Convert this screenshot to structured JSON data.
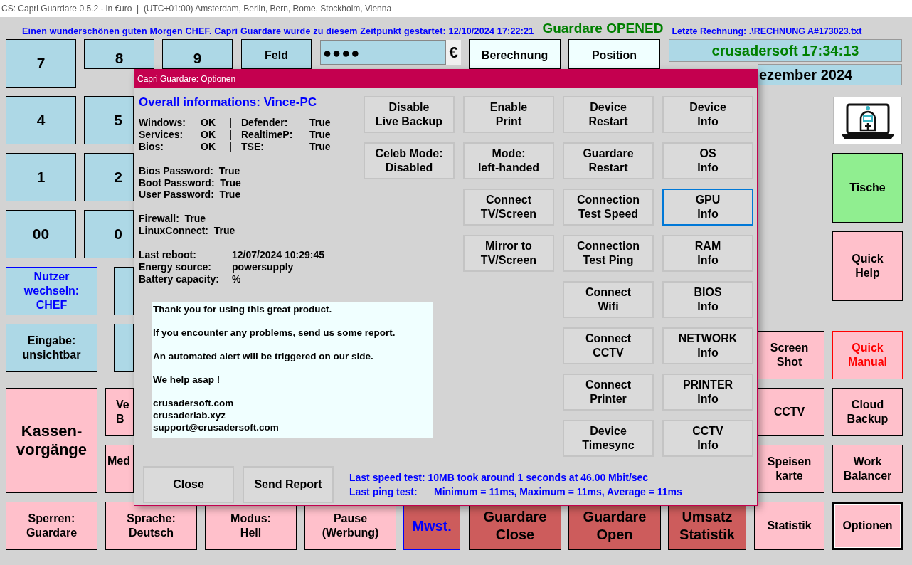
{
  "window": {
    "title": "CS: Capri Guardare 0.5.2 - in €uro  |  (UTC+01:00) Amsterdam, Berlin, Bern, Rome, Stockholm, Vienna"
  },
  "header": {
    "greeting": "Einen wunderschönen guten Morgen CHEF. Capri Guardare wurde zu diesem Zeitpunkt gestartet: 12/10/2024 17:22:21",
    "status": "Guardare OPENED",
    "last_invoice": "Letzte Rechnung: .\\RECHNUNG A#173023.txt"
  },
  "pin_field": {
    "value": "●●●●",
    "currency": "€"
  },
  "clock": "crusadersoft 17:34:13",
  "date": "ezember 2024",
  "buttons": [
    {
      "label": "7",
      "kind": "digit",
      "color": "#add8e6",
      "focused": false
    },
    {
      "label": "8",
      "kind": "digit",
      "color": "#add8e6",
      "focused": false
    },
    {
      "label": "9",
      "kind": "digit",
      "color": "#add8e6",
      "focused": false
    },
    {
      "label": "Feld",
      "kind": "normal",
      "color": "#add8e6",
      "focused": false
    },
    {
      "label": "Berechnung",
      "kind": "normal",
      "color": "#f0ffff",
      "focused": false
    },
    {
      "label": "Position",
      "kind": "normal",
      "color": "#f0ffff",
      "focused": false
    },
    {
      "label": "4",
      "kind": "digit",
      "color": "#add8e6",
      "focused": false
    },
    {
      "label": "5",
      "kind": "digit",
      "color": "#add8e6",
      "focused": false
    },
    {
      "label": "1",
      "kind": "digit",
      "color": "#add8e6",
      "focused": false
    },
    {
      "label": "2",
      "kind": "digit",
      "color": "#add8e6",
      "focused": false
    },
    {
      "label": "00",
      "kind": "digit",
      "color": "#add8e6",
      "focused": false
    },
    {
      "label": "0",
      "kind": "digit",
      "color": "#add8e6",
      "focused": false
    },
    {
      "label": "Nutzer\nwechseln:\nCHEF",
      "kind": "user",
      "color": "#add8e6",
      "focused": false
    },
    {
      "label": "Eingabe:\nunsichtbar",
      "kind": "normal",
      "color": "#add8e6",
      "focused": false
    },
    {
      "label": "Kassen-\nvorgänge",
      "kind": "large",
      "color": "#ffc0cb",
      "focused": false
    },
    {
      "label": "Ve\nB",
      "kind": "normal",
      "color": "#ffc0cb",
      "focused": false
    },
    {
      "label": "Med",
      "kind": "normal",
      "color": "#ffc0cb",
      "focused": false
    },
    {
      "label": "Sperren:\nGuardare",
      "kind": "normal",
      "color": "#ffc0cb",
      "focused": false
    },
    {
      "label": "Sprache:\nDeutsch",
      "kind": "normal",
      "color": "#ffc0cb",
      "focused": false
    },
    {
      "label": "Modus:\nHell",
      "kind": "normal",
      "color": "#ffc0cb",
      "focused": false
    },
    {
      "label": "Pause\n(Werbung)",
      "kind": "normal",
      "color": "#ffc0cb",
      "focused": false
    },
    {
      "label": "Mwst.",
      "kind": "tax",
      "color": "#cd5c5c",
      "focused": false
    },
    {
      "label": "Guardare\nClose",
      "kind": "medium",
      "color": "#cd5c5c",
      "focused": false
    },
    {
      "label": "Guardare\nOpen",
      "kind": "medium",
      "color": "#cd5c5c",
      "focused": false
    },
    {
      "label": "Umsatz\nStatistik",
      "kind": "medium",
      "color": "#cd5c5c",
      "focused": false
    },
    {
      "label": "Tische",
      "kind": "normal",
      "color": "#90ee90",
      "focused": false
    },
    {
      "label": "Quick\nHelp",
      "kind": "normal",
      "color": "#ffc0cb",
      "focused": false
    },
    {
      "label": "Screen\nShot",
      "kind": "normal",
      "color": "#ffc0cb",
      "focused": false
    },
    {
      "label": "Quick\nManual",
      "kind": "alert",
      "color": "#ffc0cb",
      "focused": false
    },
    {
      "label": "CCTV",
      "kind": "normal",
      "color": "#ffc0cb",
      "focused": false
    },
    {
      "label": "Cloud\nBackup",
      "kind": "normal",
      "color": "#ffc0cb",
      "focused": false
    },
    {
      "label": "Speisen\nkarte",
      "kind": "normal",
      "color": "#ffc0cb",
      "focused": false
    },
    {
      "label": "Work\nBalancer",
      "kind": "normal",
      "color": "#ffc0cb",
      "focused": false
    },
    {
      "label": "Statistik",
      "kind": "normal",
      "color": "#ffc0cb",
      "focused": false
    },
    {
      "label": "Optionen",
      "kind": "normal",
      "color": "#ffc0cb",
      "focused": true
    }
  ],
  "dialog": {
    "title": "Capri Guardare: Optionen",
    "heading": "Overall informations: Vince-PC",
    "status_rows": [
      [
        "Windows:",
        "OK",
        "|",
        "Defender:",
        "True"
      ],
      [
        "Services:",
        "OK",
        "|",
        "RealtimeP:",
        "True"
      ],
      [
        "Bios:",
        "OK",
        "|",
        "TSE:",
        "True"
      ]
    ],
    "password_lines": [
      "Bios Password:  True",
      "Boot Password:  True",
      "User Password:  True"
    ],
    "connection_lines": [
      "Firewall:  True",
      "LinuxConnect:  True"
    ],
    "system_rows": [
      {
        "label": "Last reboot:",
        "value": "12/07/2024 10:29:45"
      },
      {
        "label": "Energy source:",
        "value": "powersupply"
      },
      {
        "label": "Battery capacity:",
        "value": "%"
      }
    ],
    "message": [
      "Thank you for using this great product.",
      "If you encounter any problems, send us some report.",
      "An automated alert will be triggered on our side.",
      "We help asap !",
      "crusadersoft.com\ncrusaderlab.xyz\nsupport@crusadersoft.com"
    ],
    "action_columns": [
      [
        {
          "label": "Disable\nLive Backup",
          "focused": false
        },
        {
          "label": "Celeb Mode:\nDisabled",
          "focused": false
        }
      ],
      [
        {
          "label": "Enable\nPrint",
          "focused": false
        },
        {
          "label": "Mode:\nleft-handed",
          "focused": false
        },
        {
          "label": "Connect\nTV/Screen",
          "focused": false
        },
        {
          "label": "Mirror to\nTV/Screen",
          "focused": false
        }
      ],
      [
        {
          "label": "Device\nRestart",
          "focused": false
        },
        {
          "label": "Guardare\nRestart",
          "focused": false
        },
        {
          "label": "Connection\nTest Speed",
          "focused": false
        },
        {
          "label": "Connection\nTest Ping",
          "focused": false
        },
        {
          "label": "Connect\nWifi",
          "focused": false
        },
        {
          "label": "Connect\nCCTV",
          "focused": false
        },
        {
          "label": "Connect\nPrinter",
          "focused": false
        },
        {
          "label": "Device\nTimesync",
          "focused": false
        }
      ],
      [
        {
          "label": "Device\nInfo",
          "focused": false
        },
        {
          "label": "OS\nInfo",
          "focused": false
        },
        {
          "label": "GPU\nInfo",
          "focused": true
        },
        {
          "label": "RAM\nInfo",
          "focused": false
        },
        {
          "label": "BIOS\nInfo",
          "focused": false
        },
        {
          "label": "NETWORK\nInfo",
          "focused": false
        },
        {
          "label": "PRINTER\nInfo",
          "focused": false
        },
        {
          "label": "CCTV\nInfo",
          "focused": false
        }
      ]
    ],
    "footer_buttons": [
      "Close",
      "Send Report"
    ],
    "test_results": [
      "Last speed test: 10MB took around 1 seconds at 46.00 Mbit/sec",
      "Last ping test:      Minimum = 11ms, Maximum = 11ms, Average = 11ms"
    ]
  }
}
